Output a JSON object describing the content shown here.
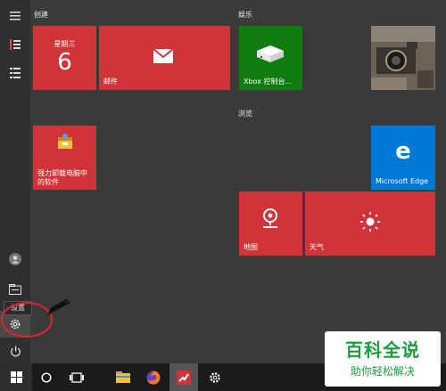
{
  "groups": {
    "create": "创建",
    "entertainment": "娱乐",
    "browse": "浏览"
  },
  "tiles": {
    "calendar": {
      "weekday": "星期三",
      "day": "6"
    },
    "mail": "邮件",
    "xbox": "Xbox 控制台...",
    "uninstaller": "强力卸载电脑中\n的软件",
    "edge": "Microsoft Edge",
    "maps": "地图",
    "weather": "天气"
  },
  "tooltip": "设置",
  "watermark": {
    "title": "百科全说",
    "subtitle": "助你轻松解决"
  },
  "colors": {
    "tile_red": "#d13438",
    "xbox_green": "#107c10",
    "edge_blue": "#0078d7",
    "annotation_red": "#e8222b",
    "watermark_green": "#1a9c3e"
  },
  "icons": [
    "hamburger-icon",
    "pinned-tiles-icon",
    "all-apps-icon",
    "user-avatar-icon",
    "documents-icon",
    "settings-icon",
    "power-icon",
    "windows-start-icon",
    "search-circle-icon",
    "task-view-icon",
    "file-explorer-icon",
    "firefox-icon",
    "red-app-icon",
    "settings-gear-icon"
  ]
}
